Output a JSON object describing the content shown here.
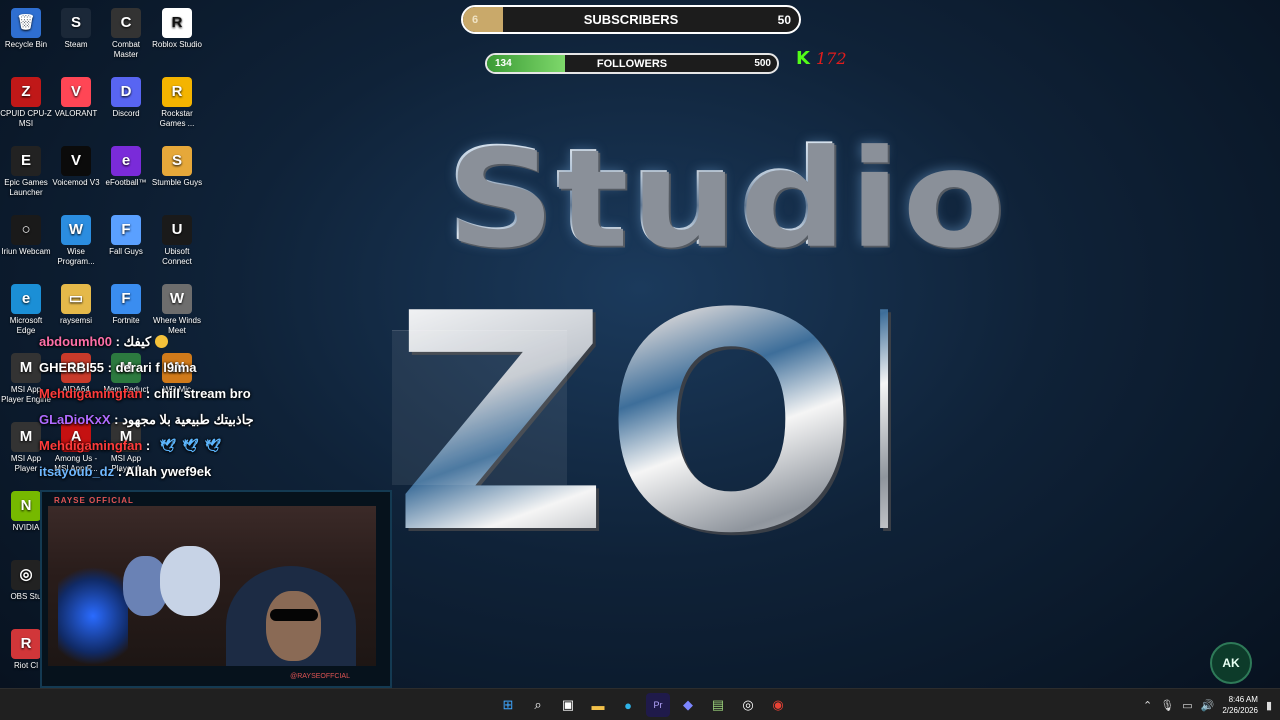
{
  "desktop_icons": [
    {
      "label": "Recycle Bin",
      "icon": "recycle-bin-icon",
      "color": "#2f6fd1",
      "glyph": "🗑"
    },
    {
      "label": "Steam",
      "icon": "steam-icon",
      "color": "#1b2838",
      "glyph": "S"
    },
    {
      "label": "Combat Master",
      "icon": "combat-master-icon",
      "color": "#333333",
      "glyph": "C"
    },
    {
      "label": "Roblox Studio",
      "icon": "roblox-studio-icon",
      "color": "#ffffff",
      "glyph": "R"
    },
    {
      "label": "CPUID CPU-Z MSI",
      "icon": "cpuz-icon",
      "color": "#c01818",
      "glyph": "Z"
    },
    {
      "label": "VALORANT",
      "icon": "valorant-icon",
      "color": "#ff4655",
      "glyph": "V"
    },
    {
      "label": "Discord",
      "icon": "discord-icon",
      "color": "#5865f2",
      "glyph": "D"
    },
    {
      "label": "Rockstar Games ...",
      "icon": "rockstar-icon",
      "color": "#f4b400",
      "glyph": "R"
    },
    {
      "label": "Epic Games Launcher",
      "icon": "epic-games-icon",
      "color": "#222222",
      "glyph": "E"
    },
    {
      "label": "Voicemod V3",
      "icon": "voicemod-icon",
      "color": "#0b0b0b",
      "glyph": "V"
    },
    {
      "label": "eFootball™",
      "icon": "efootball-icon",
      "color": "#7a2bd9",
      "glyph": "e"
    },
    {
      "label": "Stumble Guys",
      "icon": "stumble-guys-icon",
      "color": "#e6a83a",
      "glyph": "S"
    },
    {
      "label": "Iriun Webcam",
      "icon": "iriun-webcam-icon",
      "color": "#1a1a1a",
      "glyph": "○"
    },
    {
      "label": "Wise Program...",
      "icon": "wise-program-icon",
      "color": "#2b8de0",
      "glyph": "W"
    },
    {
      "label": "Fall Guys",
      "icon": "fall-guys-icon",
      "color": "#5aa0ff",
      "glyph": "F"
    },
    {
      "label": "Ubisoft Connect",
      "icon": "ubisoft-icon",
      "color": "#1a1a1a",
      "glyph": "U"
    },
    {
      "label": "Microsoft Edge",
      "icon": "edge-icon",
      "color": "#1b8fd6",
      "glyph": "e"
    },
    {
      "label": "raysemsi",
      "icon": "folder-icon",
      "color": "#e5b94a",
      "glyph": "▭"
    },
    {
      "label": "Fortnite",
      "icon": "fortnite-icon",
      "color": "#3a8df0",
      "glyph": "F"
    },
    {
      "label": "Where Winds Meet",
      "icon": "where-winds-meet-icon",
      "color": "#6d6d6d",
      "glyph": "W"
    },
    {
      "label": "MSI App Player Engine",
      "icon": "msi-app-player-icon",
      "color": "#333333",
      "glyph": "M"
    },
    {
      "label": "AIDA64",
      "icon": "aida64-icon",
      "color": "#c83a2a",
      "glyph": "64"
    },
    {
      "label": "Mem Reduct",
      "icon": "mem-reduct-icon",
      "color": "#2c7a3f",
      "glyph": "M"
    },
    {
      "label": "WD Mic",
      "icon": "wd-mic-icon",
      "color": "#d07a1a",
      "glyph": "W"
    },
    {
      "label": "MSI App Player",
      "icon": "msi-app-player-icon",
      "color": "#333333",
      "glyph": "M"
    },
    {
      "label": "Among Us - MSI App P...",
      "icon": "among-us-icon",
      "color": "#c51111",
      "glyph": "A"
    },
    {
      "label": "MSI App Player 1",
      "icon": "msi-app-player-icon",
      "color": "#333333",
      "glyph": "M"
    },
    {
      "label": "NVIDIA",
      "icon": "nvidia-icon",
      "color": "#76b900",
      "glyph": "N"
    },
    {
      "label": "OBS Stu",
      "icon": "obs-icon",
      "color": "#222222",
      "glyph": "◎"
    },
    {
      "label": "Riot Cl",
      "icon": "riot-client-icon",
      "color": "#d13639",
      "glyph": "R"
    }
  ],
  "goals": {
    "subscribers": {
      "label": "SUBSCRIBERS",
      "current": "6",
      "target": "50",
      "progress": 0.12
    },
    "followers": {
      "label": "FOLLOWERS",
      "current": "134",
      "target": "500",
      "progress": 0.268
    }
  },
  "kick": {
    "logo": "K",
    "count": "172",
    "color": "#53fc18"
  },
  "logo": {
    "line1": "Studio",
    "line2": "ZONE"
  },
  "chat": [
    {
      "user": "abdoumh00",
      "color": "#ff6fa8",
      "message": "كيفك",
      "extra": "face"
    },
    {
      "user": "GHERBI55",
      "color": "#ffffff",
      "message": "derari f l9ima",
      "extra": ""
    },
    {
      "user": "Mehdigamingfan",
      "color": "#ff3b3b",
      "message": "chill stream bro",
      "extra": ""
    },
    {
      "user": "GLaDioKxX",
      "color": "#b06bff",
      "message": "جاذبيتك طبيعية بلا مجهود",
      "extra": ""
    },
    {
      "user": "Mehdigamingfan",
      "color": "#ff3b3b",
      "message": "",
      "extra": "birds"
    },
    {
      "user": "itsayoub_dz",
      "color": "#6fb8ff",
      "message": "Allah ywef9ek",
      "extra": ""
    }
  ],
  "webcam": {
    "title": "RAYSE OFFICIAL",
    "handle": "@RAYSEOFFCIAL"
  },
  "taskbar": {
    "apps": [
      "windows-start-icon",
      "search-icon",
      "task-view-icon",
      "file-explorer-icon",
      "edge-icon",
      "premiere-icon",
      "discord-icon",
      "terminal-icon",
      "obs-icon",
      "chrome-icon"
    ],
    "time": "8:46 AM",
    "date": "2/26/2026"
  },
  "corner_logo": {
    "text": "AK"
  }
}
